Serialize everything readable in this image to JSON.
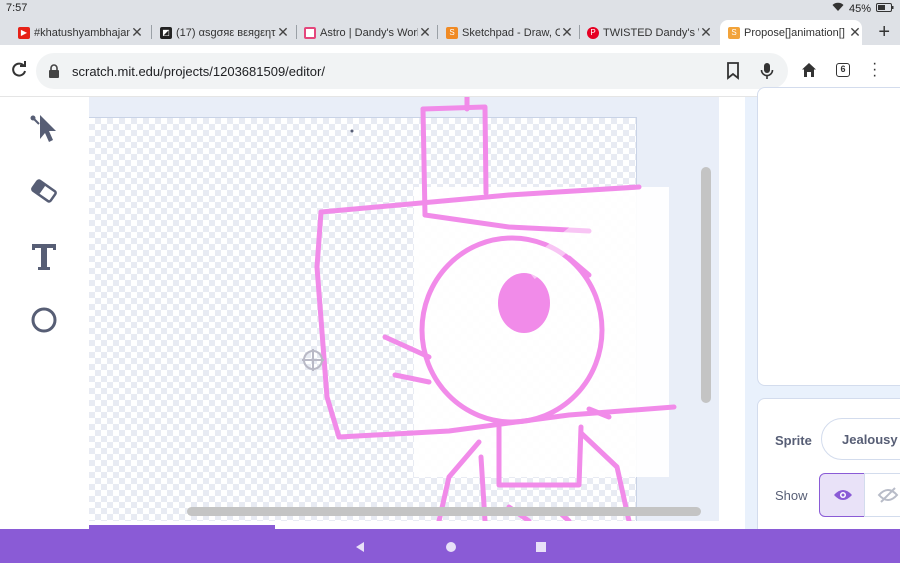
{
  "status": {
    "time": "7:57",
    "battery": "45%"
  },
  "tabs": [
    {
      "title": "#khatushyambhajan",
      "favicon": "youtube-icon",
      "color": "#e62117"
    },
    {
      "title": "(17) αsgσяε вεяgεητ",
      "favicon": "site-icon",
      "color": "#222222"
    },
    {
      "title": "Astro | Dandy's World",
      "favicon": "fandom-icon",
      "color": "#e4467c"
    },
    {
      "title": "Sketchpad - Draw, Cre",
      "favicon": "sketchpad-icon",
      "color": "#f08a24"
    },
    {
      "title": "TWISTED Dandy's Wo",
      "favicon": "pinterest-icon",
      "color": "#e60023"
    },
    {
      "title": "Propose[]animation[]",
      "favicon": "scratch-icon",
      "color": "#f2a33a",
      "active": true
    }
  ],
  "address_bar": {
    "url": "scratch.mit.edu/projects/1203681509/editor/"
  },
  "tab_count": "6",
  "sprite_panel": {
    "sprite_label": "Sprite",
    "sprite_name": "Jealousy",
    "show_label": "Show"
  },
  "colors": {
    "accent": "#8a5bd6",
    "drawing": "#f18be9",
    "panel": "#e9f1fc"
  }
}
